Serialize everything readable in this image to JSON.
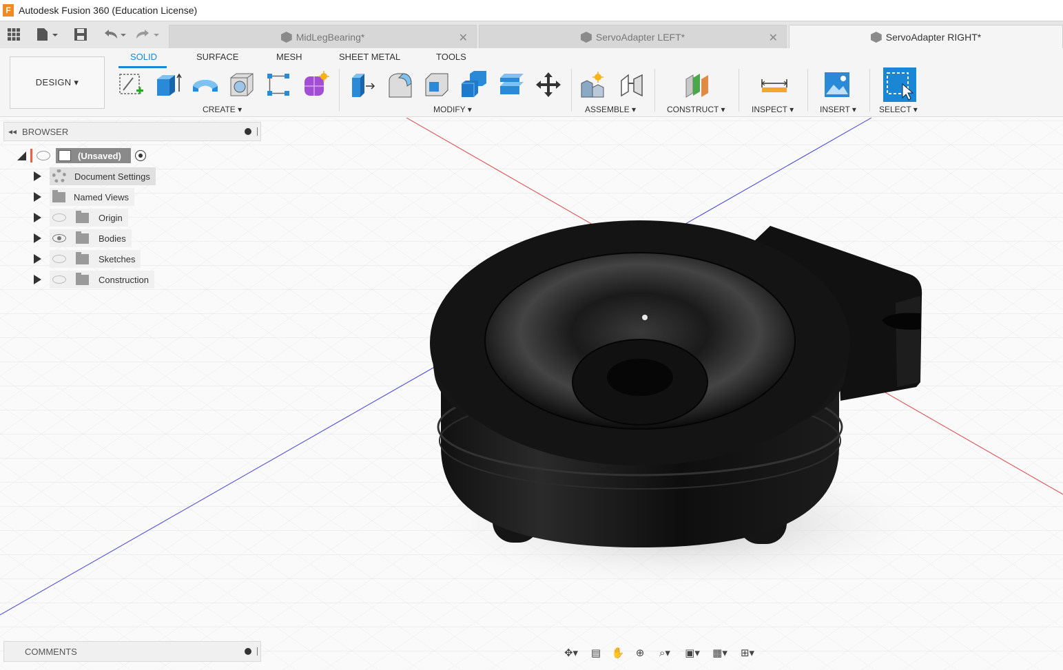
{
  "window": {
    "title": "Autodesk Fusion 360 (Education License)",
    "logo_letter": "F"
  },
  "tabs": [
    {
      "label": "MidLegBearing*",
      "active": false
    },
    {
      "label": "ServoAdapter LEFT*",
      "active": false
    },
    {
      "label": "ServoAdapter RIGHT*",
      "active": true
    }
  ],
  "tab_close_glyph": "✕",
  "workspace": {
    "label": "DESIGN ▾"
  },
  "ribbon_tabs": [
    "SOLID",
    "SURFACE",
    "MESH",
    "SHEET METAL",
    "TOOLS"
  ],
  "groups": {
    "create": "CREATE ▾",
    "modify": "MODIFY ▾",
    "assemble": "ASSEMBLE ▾",
    "construct": "CONSTRUCT ▾",
    "inspect": "INSPECT ▾",
    "insert": "INSERT ▾",
    "select": "SELECT ▾"
  },
  "browser": {
    "title": "BROWSER",
    "root": "(Unsaved)",
    "items": [
      {
        "label": "Document Settings"
      },
      {
        "label": "Named Views"
      },
      {
        "label": "Origin"
      },
      {
        "label": "Bodies"
      },
      {
        "label": "Sketches"
      },
      {
        "label": "Construction"
      }
    ]
  },
  "comments": {
    "title": "COMMENTS"
  },
  "colors": {
    "accent": "#1a86d6",
    "model": "#0d0d0d",
    "x_axis": "#e04040",
    "z_axis": "#4040e0"
  }
}
